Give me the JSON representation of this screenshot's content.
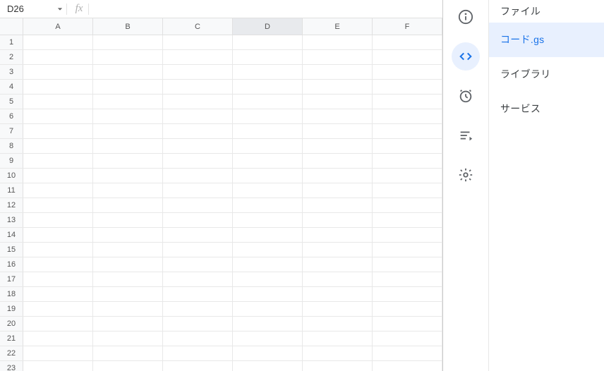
{
  "namebox": {
    "value": "D26"
  },
  "fx": {
    "label": "fx",
    "value": ""
  },
  "columns": [
    "A",
    "B",
    "C",
    "D",
    "E",
    "F"
  ],
  "rows": [
    1,
    2,
    3,
    4,
    5,
    6,
    7,
    8,
    9,
    10,
    11,
    12,
    13,
    14,
    15,
    16,
    17,
    18,
    19,
    20,
    21,
    22,
    23
  ],
  "selectedColumn": "D",
  "rail": {
    "info": "info-icon",
    "editor": "code-icon",
    "triggers": "clock-icon",
    "executions": "list-icon",
    "settings": "gear-icon"
  },
  "files": {
    "header": "ファイル",
    "items": [
      {
        "label": "コード.gs",
        "active": true
      },
      {
        "label": "ライブラリ",
        "active": false
      },
      {
        "label": "サービス",
        "active": false
      }
    ]
  }
}
